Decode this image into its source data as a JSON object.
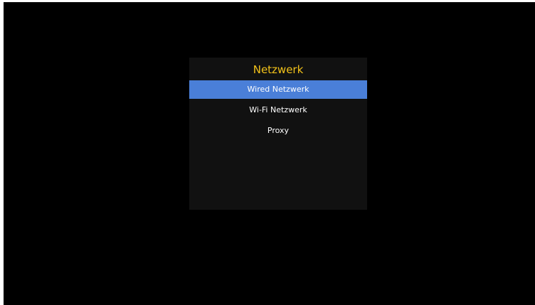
{
  "dialog": {
    "title": "Netzwerk",
    "title_color": "#f2c21a",
    "selected_color": "#4a7fd8",
    "items": [
      {
        "label": "Wired Netzwerk",
        "selected": true
      },
      {
        "label": "Wi-Fi Netzwerk",
        "selected": false
      },
      {
        "label": "Proxy",
        "selected": false
      }
    ]
  }
}
